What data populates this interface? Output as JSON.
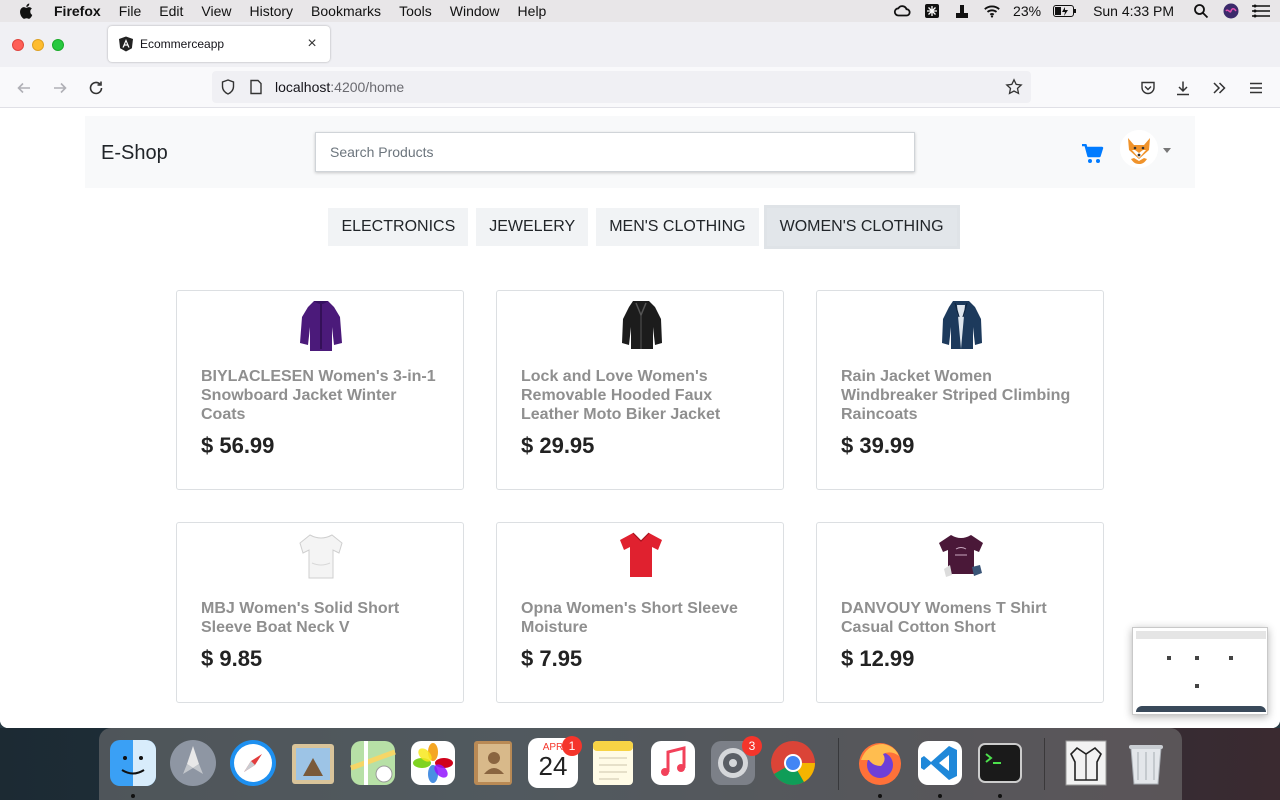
{
  "menubar": {
    "app": "Firefox",
    "items": [
      "File",
      "Edit",
      "View",
      "History",
      "Bookmarks",
      "Tools",
      "Window",
      "Help"
    ],
    "battery": "23%",
    "clock": "Sun 4:33 PM"
  },
  "browser": {
    "tab_title": "Ecommerceapp",
    "url_host": "localhost",
    "url_rest": ":4200/home"
  },
  "app": {
    "brand": "E-Shop",
    "search_placeholder": "Search Products",
    "categories": [
      "ELECTRONICS",
      "JEWELERY",
      "MEN'S CLOTHING",
      "WOMEN'S CLOTHING"
    ],
    "active_category": "WOMEN'S CLOTHING",
    "products": [
      {
        "name": "BIYLACLESEN Women's 3-in-1 Snowboard Jacket Winter Coats",
        "price": "$ 56.99",
        "icon": "purple-jacket"
      },
      {
        "name": "Lock and Love Women's Removable Hooded Faux Leather Moto Biker Jacket",
        "price": "$ 29.95",
        "icon": "black-leather-jacket"
      },
      {
        "name": "Rain Jacket Women Windbreaker Striped Climbing Raincoats",
        "price": "$ 39.99",
        "icon": "navy-rain-jacket"
      },
      {
        "name": "MBJ Women's Solid Short Sleeve Boat Neck V",
        "price": "$ 9.85",
        "icon": "white-top"
      },
      {
        "name": "Opna Women's Short Sleeve Moisture",
        "price": "$ 7.95",
        "icon": "red-tshirt"
      },
      {
        "name": "DANVOUY Womens T Shirt Casual Cotton Short",
        "price": "$ 12.99",
        "icon": "purple-tshirt"
      }
    ]
  },
  "dock": {
    "calendar_month": "APR",
    "calendar_day": "24",
    "calendar_badge": "1",
    "settings_badge": "3"
  },
  "colors": {
    "accent": "#007bff",
    "header_bg": "#f8f9fa",
    "product_name": "#8f8f8f"
  }
}
